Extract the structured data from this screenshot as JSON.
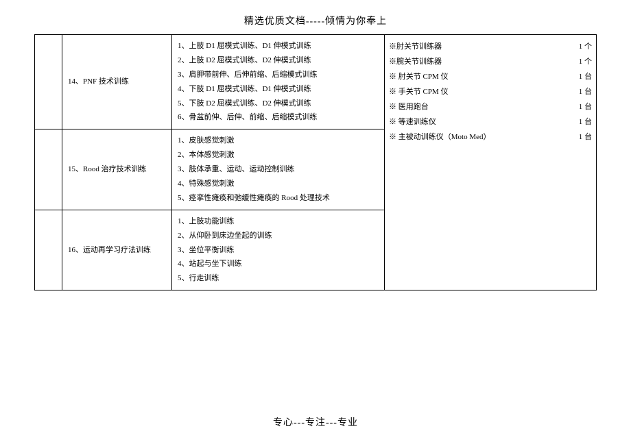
{
  "header": "精选优质文档-----倾情为你奉上",
  "footer": "专心---专注---专业",
  "rows": [
    {
      "title": "14、PNF 技术训练",
      "items": [
        "1、上肢 D1 屈模式训练、D1 伸模式训练",
        "2、上肢 D2 屈模式训练、D2 伸模式训练",
        "3、肩胛带前伸、后伸前缩、后缩模式训练",
        "4、下肢 D1 屈模式训练、D1 伸模式训练",
        "5、下肢 D2 屈模式训练、D2 伸模式训练",
        "6、骨盆前伸、后伸、前缩、后缩模式训练"
      ]
    },
    {
      "title": "15、Rood 治疗技术训练",
      "items": [
        "1、皮肤感觉刺激",
        "2、本体感觉刺激",
        "3、肢体承重、运动、运动控制训练",
        "4、特殊感觉刺激",
        "5、痉挛性瘫痪和弛缓性瘫痪的 Rood 处理技术"
      ]
    },
    {
      "title": "16、运动再学习疗法训练",
      "items": [
        "1、上肢功能训练",
        "2、从仰卧到床边坐起的训练",
        "3、坐位平衡训练",
        "4、站起与坐下训练",
        "5、行走训练"
      ]
    }
  ],
  "equipment": [
    {
      "label": "※肘关节训练器",
      "qty": "1 个"
    },
    {
      "label": "※腕关节训练器",
      "qty": "1 个"
    },
    {
      "label": "※ 肘关节 CPM 仪",
      "qty": "1 台"
    },
    {
      "label": "※ 手关节 CPM 仪",
      "qty": "1 台"
    },
    {
      "label": "※ 医用跑台",
      "qty": "1 台"
    },
    {
      "label": "※ 等速训练仪",
      "qty": "1 台"
    },
    {
      "label": "※ 主被动训练仪（Moto Med）",
      "qty": "1 台"
    }
  ]
}
